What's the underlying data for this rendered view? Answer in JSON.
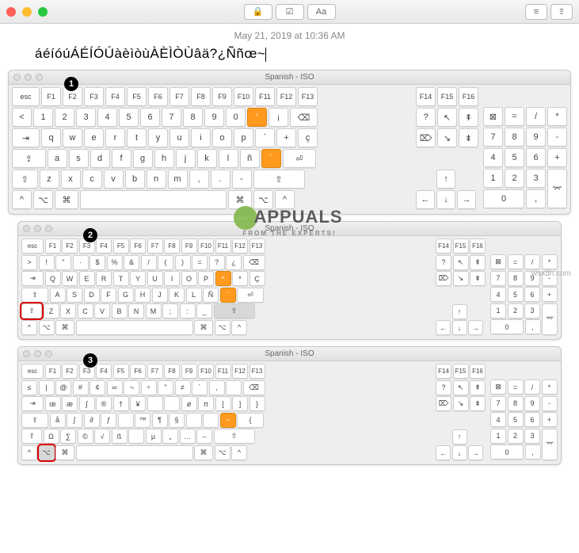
{
  "titlebar": {
    "center_icons": [
      "lock",
      "check",
      "Aa"
    ],
    "right_icons": [
      "list",
      "share"
    ]
  },
  "date": "May 21, 2019 at 10:36 AM",
  "editor_text": "áéíóúÁÉÍÓÚàèìòùÀÈÌÒÙâä?¿Ññœ~",
  "watermark": {
    "main": "APPUALS",
    "sub": "FROM THE EXPERTS!"
  },
  "source": "wsxdn.com",
  "keyboards": [
    {
      "title": "Spanish - ISO",
      "badge": "1",
      "size": "large",
      "rows": {
        "fn": [
          "esc",
          "F1",
          "F2",
          "F3",
          "F4",
          "F5",
          "F6",
          "F7",
          "F8",
          "F9",
          "F10",
          "F11",
          "F12",
          "F13"
        ],
        "fn2": [
          "F14",
          "F15",
          "F16"
        ],
        "num": [
          "<",
          "1",
          "2",
          "3",
          "4",
          "5",
          "6",
          "7",
          "8",
          "9",
          "0",
          "'",
          "¡",
          "⌫"
        ],
        "numR": [
          "?",
          "↖",
          "⇞"
        ],
        "np0": [
          "⊠",
          "=",
          "/",
          "*"
        ],
        "tab": [
          "⇥",
          "q",
          "w",
          "e",
          "r",
          "t",
          "y",
          "u",
          "i",
          "o",
          "p",
          "`",
          "+",
          "ç"
        ],
        "tabR": [
          "⌦",
          "↘",
          "⇟"
        ],
        "np1": [
          "7",
          "8",
          "9",
          "-"
        ],
        "caps": [
          "⇪",
          "a",
          "s",
          "d",
          "f",
          "g",
          "h",
          "j",
          "k",
          "l",
          "ñ",
          "´",
          "⏎"
        ],
        "np2": [
          "4",
          "5",
          "6",
          "+"
        ],
        "shift": [
          "⇧",
          "z",
          "x",
          "c",
          "v",
          "b",
          "n",
          "m",
          ",",
          ".",
          "-",
          "⇧"
        ],
        "np3": [
          "1",
          "2",
          "3"
        ],
        "bottom": [
          "^",
          "⌥",
          "⌘",
          " ",
          "⌘",
          "⌥",
          "^"
        ],
        "np4": [
          "0",
          ","
        ],
        "arrows": [
          "↑",
          "←",
          "↓",
          "→"
        ]
      },
      "orange_keys": [
        "r0c11",
        "r2c11"
      ],
      "red_keys": []
    },
    {
      "title": "Spanish - ISO",
      "badge": "2",
      "size": "small",
      "rows": {
        "fn": [
          "esc",
          "F1",
          "F2",
          "F3",
          "F4",
          "F5",
          "F6",
          "F7",
          "F8",
          "F9",
          "F10",
          "F11",
          "F12",
          "F13"
        ],
        "fn2": [
          "F14",
          "F15",
          "F16"
        ],
        "num": [
          ">",
          "!",
          "\"",
          "·",
          "$",
          "%",
          "&",
          "/",
          "(",
          ")",
          "=",
          "?",
          "¿",
          "⌫"
        ],
        "numR": [
          "?",
          "↖",
          "⇞"
        ],
        "np0": [
          "⊠",
          "=",
          "/",
          "*"
        ],
        "tab": [
          "⇥",
          "Q",
          "W",
          "E",
          "R",
          "T",
          "Y",
          "U",
          "I",
          "O",
          "P",
          "^",
          "*",
          "Ç"
        ],
        "tabR": [
          "⌦",
          "↘",
          "⇟"
        ],
        "np1": [
          "7",
          "8",
          "9",
          "-"
        ],
        "caps": [
          "⇪",
          "A",
          "S",
          "D",
          "F",
          "G",
          "H",
          "J",
          "K",
          "L",
          "Ñ",
          "¨",
          "⏎"
        ],
        "np2": [
          "4",
          "5",
          "6",
          "+"
        ],
        "shift": [
          "⇧",
          "Z",
          "X",
          "C",
          "V",
          "B",
          "N",
          "M",
          ";",
          ":",
          "_",
          "⇧"
        ],
        "np3": [
          "1",
          "2",
          "3"
        ],
        "bottom": [
          "^",
          "⌥",
          "⌘",
          " ",
          "⌘",
          "⌥",
          "^"
        ],
        "np4": [
          "0",
          ","
        ],
        "arrows": [
          "↑",
          "←",
          "↓",
          "→"
        ]
      },
      "orange_keys": [
        "r1c11",
        "r2c11"
      ],
      "red_keys": [
        "r3c0"
      ],
      "pressed_keys": [
        "r3c11"
      ]
    },
    {
      "title": "Spanish - ISO",
      "badge": "3",
      "size": "small",
      "rows": {
        "fn": [
          "esc",
          "F1",
          "F2",
          "F3",
          "F4",
          "F5",
          "F6",
          "F7",
          "F8",
          "F9",
          "F10",
          "F11",
          "F12",
          "F13"
        ],
        "fn2": [
          "F14",
          "F15",
          "F16"
        ],
        "num": [
          "≤",
          "|",
          "@",
          "#",
          "¢",
          "∞",
          "¬",
          "÷",
          "\"",
          "≠",
          "´",
          "‚",
          " ",
          "⌫"
        ],
        "numR": [
          "?",
          "↖",
          "⇞"
        ],
        "np0": [
          "⊠",
          "=",
          "/",
          "*"
        ],
        "tab": [
          "⇥",
          "œ",
          "æ",
          "∫",
          "®",
          "†",
          "¥",
          " ",
          " ",
          "ø",
          "π",
          "[",
          "]",
          "}"
        ],
        "tabR": [
          "⌦",
          "↘",
          "⇟"
        ],
        "np1": [
          "7",
          "8",
          "9",
          "-"
        ],
        "caps": [
          "⇪",
          "å",
          "∫",
          "∂",
          "ƒ",
          "",
          "™",
          "¶",
          "§",
          " ",
          " ",
          "~",
          "{",
          "⏎"
        ],
        "np2": [
          "4",
          "5",
          "6",
          "+"
        ],
        "shift": [
          "⇧",
          "Ω",
          "∑",
          "©",
          "√",
          "ß",
          " ",
          "µ",
          "„",
          "…",
          "–",
          "⇧"
        ],
        "np3": [
          "1",
          "2",
          "3"
        ],
        "bottom": [
          "^",
          "⌥",
          "⌘",
          " ",
          "⌘",
          "⌥",
          "^"
        ],
        "np4": [
          "0",
          ","
        ],
        "arrows": [
          "↑",
          "←",
          "↓",
          "→"
        ]
      },
      "orange_keys": [
        "r2c11"
      ],
      "red_keys": [
        "r4c1"
      ],
      "pressed_keys": [
        "r4c1"
      ]
    }
  ]
}
